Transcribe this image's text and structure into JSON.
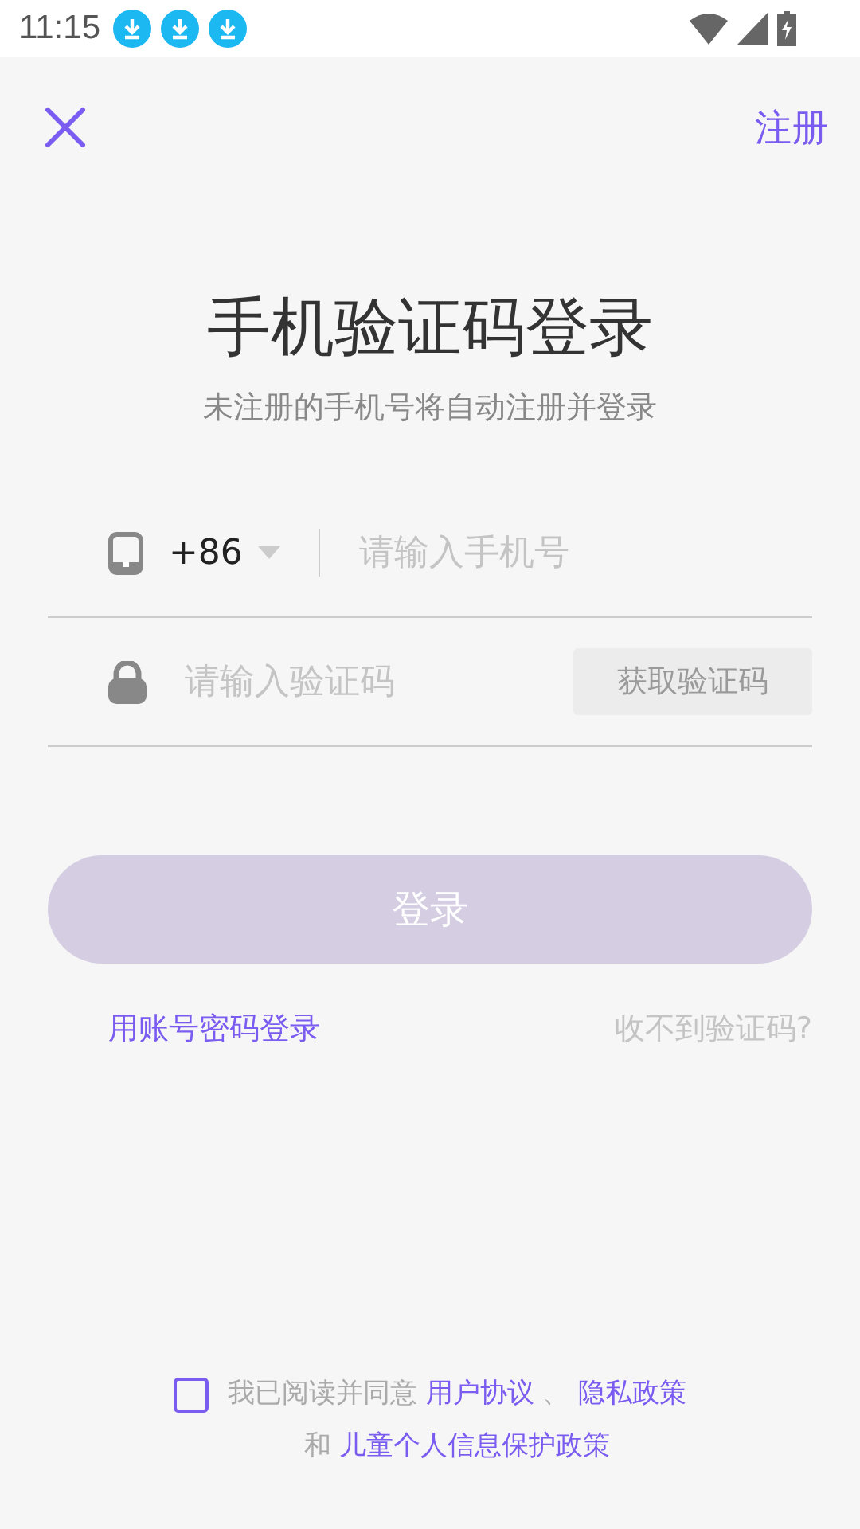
{
  "status_bar": {
    "time": "11:15",
    "notifications": [
      {
        "kind": "download"
      },
      {
        "kind": "download"
      },
      {
        "kind": "download"
      }
    ]
  },
  "top_bar": {
    "register_link": "注册"
  },
  "title": "手机验证码登录",
  "subtitle": "未注册的手机号将自动注册并登录",
  "phone_field": {
    "country_code": "+86",
    "placeholder": "请输入手机号"
  },
  "code_field": {
    "placeholder": "请输入验证码",
    "get_code_button": "获取验证码",
    "get_code_disabled": true
  },
  "login_button": {
    "label": "登录",
    "disabled": true
  },
  "links": {
    "password_login": "用账号密码登录",
    "no_code": "收不到验证码?"
  },
  "agreement": {
    "checked": false,
    "prefix": "我已阅读并同意",
    "link_1": "用户协议",
    "separator": "、",
    "link_2": "隐私政策",
    "conjunction": "和",
    "link_3": "儿童个人信息保护政策"
  }
}
